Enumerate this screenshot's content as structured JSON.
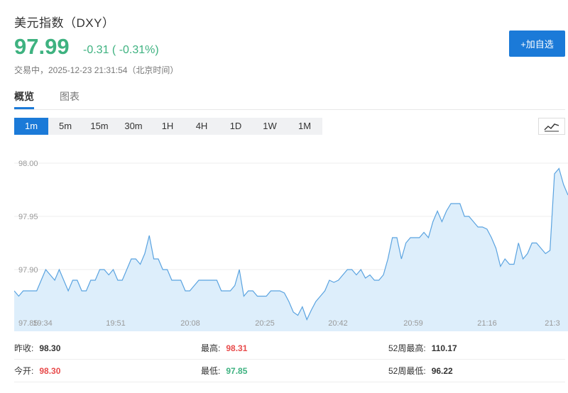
{
  "header": {
    "title": "美元指数（DXY）",
    "price": "97.99",
    "change": "-0.31 ( -0.31%)",
    "status": "交易中，2025-12-23 21:31:54（北京时间）",
    "add_watch_label": "+加自选"
  },
  "tabs": [
    {
      "label": "概览",
      "active": true
    },
    {
      "label": "图表",
      "active": false
    }
  ],
  "intervals": [
    {
      "label": "1m",
      "active": true
    },
    {
      "label": "5m",
      "active": false
    },
    {
      "label": "15m",
      "active": false
    },
    {
      "label": "30m",
      "active": false
    },
    {
      "label": "1H",
      "active": false
    },
    {
      "label": "4H",
      "active": false
    },
    {
      "label": "1D",
      "active": false
    },
    {
      "label": "1W",
      "active": false
    },
    {
      "label": "1M",
      "active": false
    }
  ],
  "chart_type_icon": "line-chart-icon",
  "colors": {
    "up": "#e84b4b",
    "down": "#3eb280",
    "accent": "#1b7ad8",
    "line": "#5aa3e0",
    "fill": "#ddeefb"
  },
  "chart_data": {
    "type": "area",
    "x_tick_labels": [
      "19:34",
      "19:51",
      "20:08",
      "20:25",
      "20:42",
      "20:59",
      "21:16",
      "21:3"
    ],
    "y_tick_labels": [
      "98.00",
      "97.95",
      "97.90",
      "97.85"
    ],
    "ylim": [
      97.85,
      98.0
    ],
    "grid": true,
    "values": [
      97.88,
      97.875,
      97.88,
      97.88,
      97.88,
      97.88,
      97.89,
      97.9,
      97.895,
      97.89,
      97.9,
      97.89,
      97.88,
      97.89,
      97.89,
      97.88,
      97.88,
      97.89,
      97.89,
      97.9,
      97.9,
      97.895,
      97.9,
      97.89,
      97.89,
      97.9,
      97.91,
      97.91,
      97.905,
      97.915,
      97.932,
      97.91,
      97.91,
      97.9,
      97.9,
      97.89,
      97.89,
      97.89,
      97.88,
      97.88,
      97.885,
      97.89,
      97.89,
      97.89,
      97.89,
      97.89,
      97.88,
      97.88,
      97.88,
      97.885,
      97.9,
      97.875,
      97.88,
      97.88,
      97.875,
      97.875,
      97.875,
      97.88,
      97.88,
      97.88,
      97.878,
      97.87,
      97.86,
      97.857,
      97.865,
      97.853,
      97.862,
      97.87,
      97.875,
      97.88,
      97.89,
      97.888,
      97.89,
      97.895,
      97.9,
      97.9,
      97.895,
      97.9,
      97.892,
      97.895,
      97.89,
      97.89,
      97.895,
      97.91,
      97.93,
      97.93,
      97.91,
      97.925,
      97.93,
      97.93,
      97.93,
      97.935,
      97.93,
      97.945,
      97.955,
      97.945,
      97.955,
      97.962,
      97.962,
      97.962,
      97.95,
      97.95,
      97.945,
      97.94,
      97.94,
      97.938,
      97.93,
      97.92,
      97.903,
      97.91,
      97.905,
      97.905,
      97.925,
      97.91,
      97.915,
      97.925,
      97.925,
      97.92,
      97.915,
      97.918,
      97.99,
      97.995,
      97.98,
      97.97
    ]
  },
  "stats": [
    {
      "label": "昨收:",
      "value": "98.30",
      "tone": "neutral"
    },
    {
      "label": "最高:",
      "value": "98.31",
      "tone": "red"
    },
    {
      "label": "52周最高:",
      "value": "110.17",
      "tone": "neutral"
    },
    {
      "label": "今开:",
      "value": "98.30",
      "tone": "red"
    },
    {
      "label": "最低:",
      "value": "97.85",
      "tone": "green"
    },
    {
      "label": "52周最低:",
      "value": "96.22",
      "tone": "neutral"
    }
  ]
}
